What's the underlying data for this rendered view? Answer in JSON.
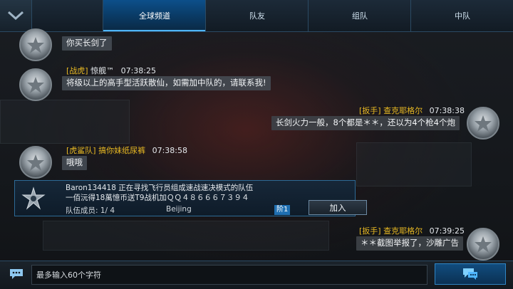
{
  "tabs": [
    {
      "label": "全球频道",
      "active": true
    },
    {
      "label": "队友",
      "active": false
    },
    {
      "label": "组队",
      "active": false
    },
    {
      "label": "中队",
      "active": false
    }
  ],
  "messages": [
    {
      "side": "left",
      "tag": "",
      "nick": "",
      "time": "",
      "text": "你买长剑了"
    },
    {
      "side": "left",
      "tag": "[战虎]",
      "nick": "惊舰™",
      "time": "07:38:25",
      "text": "将级以上的高手型活跃散仙，如需加中队的，请联系我!"
    },
    {
      "side": "right",
      "tag": "[扳手]",
      "nick": "查克耶格尔",
      "time": "07:38:38",
      "text": "长剑火力一般，8个都是＊＊，还以为4个枪4个炮"
    },
    {
      "side": "left",
      "tag": "[虎鲨队]",
      "nick": "搞你妹纸尿裤",
      "time": "07:38:58",
      "text": "哦哦"
    },
    {
      "side": "right",
      "tag": "[扳手]",
      "nick": "查克耶格尔",
      "time": "07:39:25",
      "text": "＊＊截图举报了，沙雕广告"
    }
  ],
  "invite": {
    "line1": "Baron134418 正在寻找飞行员组成速战速决模式的队伍",
    "line2": "一佰沅得18萬憶币送T9战机加ＱＱ４８６６６７３９４",
    "members": "队伍成员: 1/ 4",
    "location": "Beijing",
    "rank": "阶1",
    "join_label": "加入"
  },
  "input": {
    "placeholder": "最多输入60个字符"
  },
  "colors": {
    "accent": "#0c4f8a",
    "name_gold": "#e8b923",
    "border_blue": "#2b4a63"
  }
}
